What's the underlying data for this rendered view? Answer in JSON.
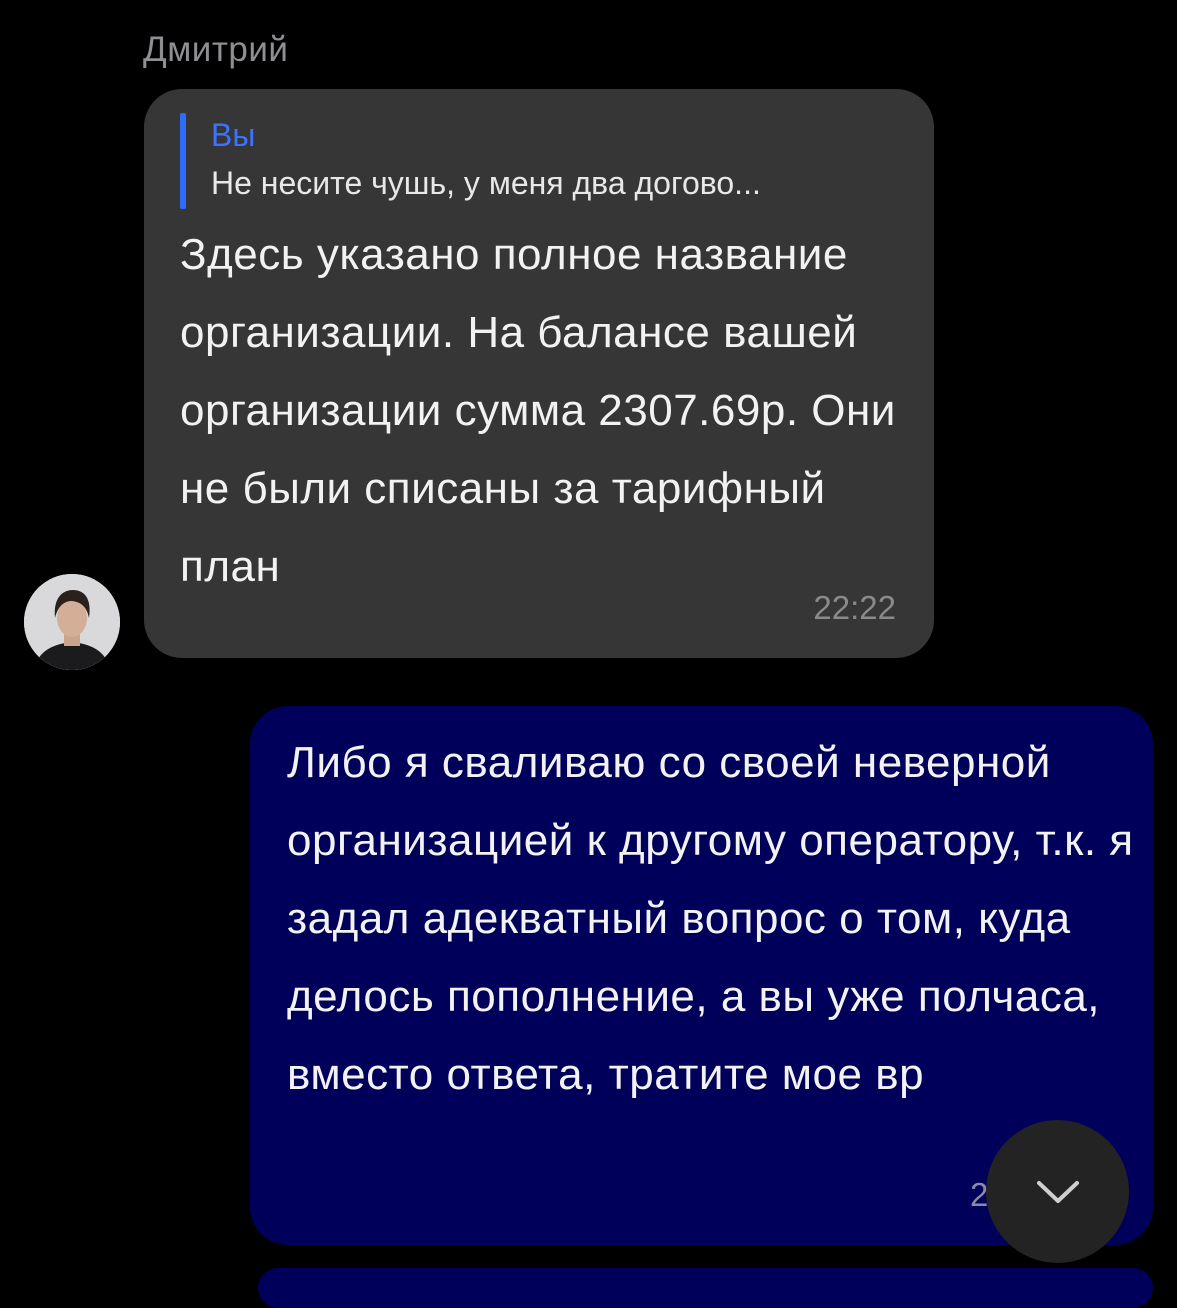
{
  "incoming": {
    "sender_name": "Дмитрий",
    "reply": {
      "author": "Вы",
      "text": "Не несите чушь, у меня два догово..."
    },
    "text": "Здесь указано полное название организации. На балансе вашей организации сумма 2307.69р. Они не были списаны за тарифный план",
    "time": "22:22"
  },
  "outgoing": {
    "text": "Либо я сваливаю со своей неверной организацией к другому оператору, т.к. я задал адекватный вопрос о том, куда делось пополнение, а вы уже полчаса, вместо ответа, тратите мое вр",
    "time": "2"
  },
  "icons": {
    "scroll_down": "chevron-down-icon",
    "avatar": "user-avatar-photo"
  },
  "colors": {
    "background": "#000000",
    "incoming_bubble": "#363636",
    "outgoing_bubble": "#00005a",
    "reply_accent": "#3b73ff",
    "time": "#8a8a8a"
  }
}
